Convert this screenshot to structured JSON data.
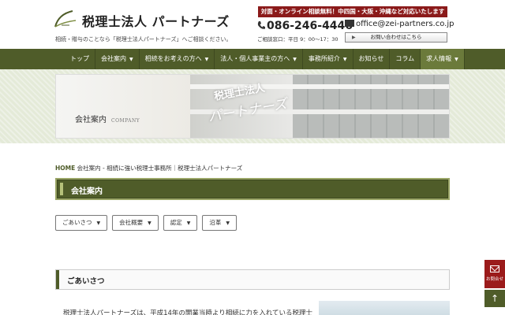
{
  "header": {
    "site_name": "税理士法人 パートナーズ",
    "tagline": "相続・贈与のことなら「税理士法人パートナーズ」へご相談ください。",
    "banner": "対面・オンライン相談無料！中四国・大阪・沖縄など対応いたします",
    "phone": "086-246-4446",
    "hours": "ご相談窓口：平日 9：00～17：30",
    "email": "office@zei-partners.co.jp",
    "contact_button": "お問い合わせはこちら"
  },
  "nav": {
    "items": [
      {
        "label": "トップ"
      },
      {
        "label": "会社案内",
        "dropdown": true
      },
      {
        "label": "相続をお考えの方へ",
        "dropdown": true
      },
      {
        "label": "法人・個人事業主の方へ",
        "dropdown": true
      },
      {
        "label": "事務所紹介",
        "dropdown": true
      },
      {
        "label": "お知らせ"
      },
      {
        "label": "コラム"
      },
      {
        "label": "求人情報",
        "dropdown": true
      }
    ],
    "dropdown_glyph": "▼"
  },
  "hero": {
    "label": "会社案内",
    "label_en": "COMPANY",
    "image_title_line1": "税理士法人",
    "image_title_line2": "パートナーズ"
  },
  "breadcrumb": {
    "home": "HOME",
    "current": "会社案内 - 相続に強い税理士事務所｜税理士法人パートナーズ"
  },
  "page_heading": "会社案内",
  "anchors": [
    {
      "label": "ごあいさつ"
    },
    {
      "label": "会社概要"
    },
    {
      "label": "認定"
    },
    {
      "label": "沿革"
    }
  ],
  "anchor_glyph": "▼",
  "section": {
    "heading": "ごあいさつ",
    "body_start": "税理士法人パートナーズは、平成14年の開業当時より相続に力を入れている税理士"
  },
  "float": {
    "contact_label": "お問合せ",
    "top_glyph": "↑"
  },
  "colors": {
    "nav_green": "#4f5c29",
    "banner_red": "#8b1a1a"
  }
}
